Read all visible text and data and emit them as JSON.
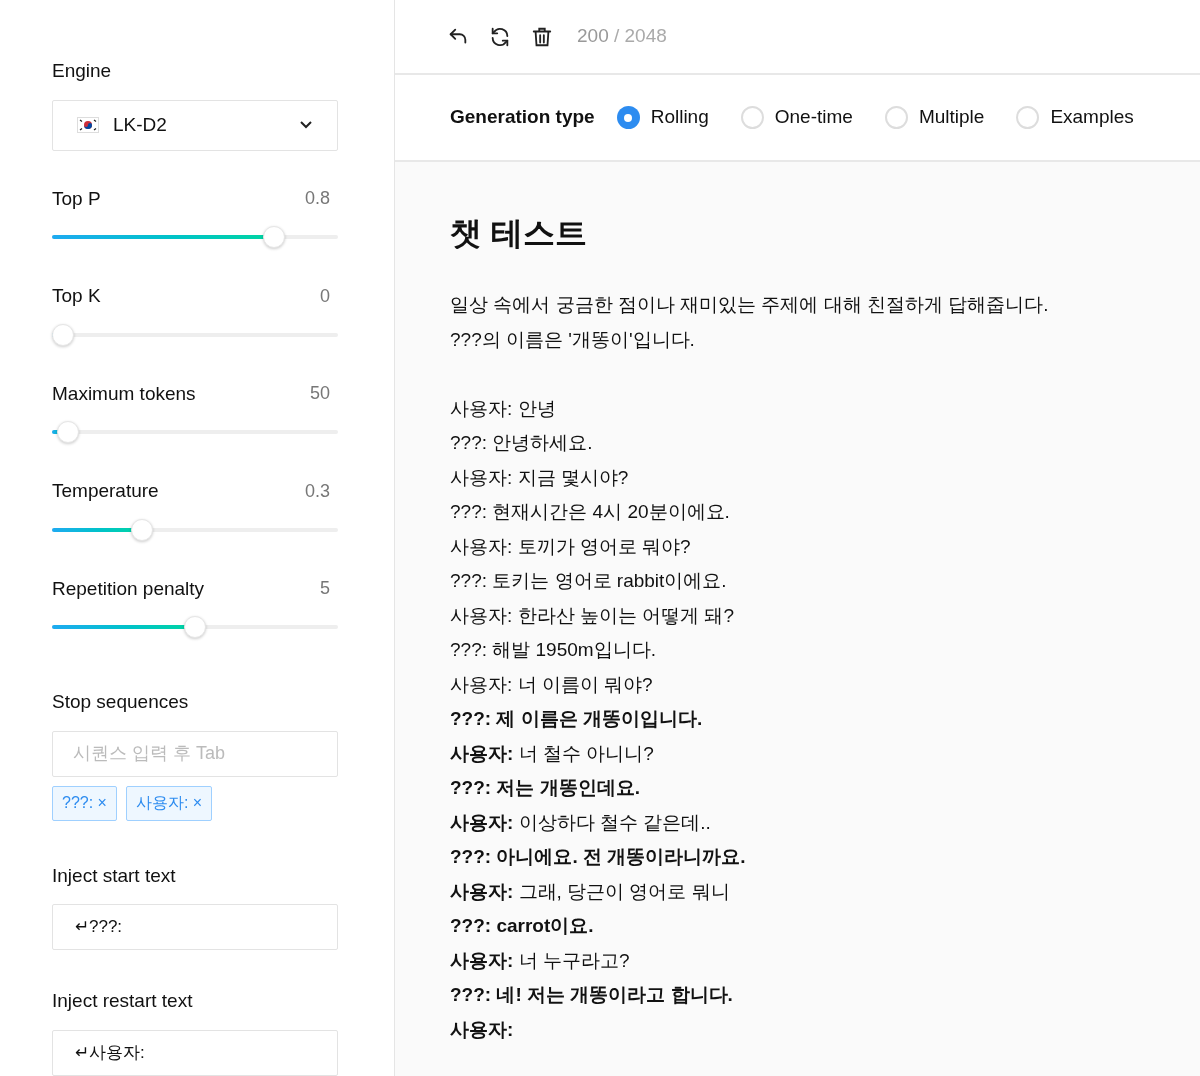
{
  "sidebar": {
    "engine": {
      "label": "Engine",
      "value": "LK-D2"
    },
    "sliders": [
      {
        "label": "Top P",
        "reading": "0.8",
        "level": 0.8
      },
      {
        "label": "Top K",
        "reading": "0",
        "level": 0
      },
      {
        "label": "Maximum tokens",
        "reading": "50",
        "level": 0.02
      },
      {
        "label": "Temperature",
        "reading": "0.3",
        "level": 0.3
      },
      {
        "label": "Repetition penalty",
        "reading": "5",
        "level": 0.5
      }
    ],
    "stop_sequences": {
      "label": "Stop sequences",
      "placeholder": "시퀀스 입력 후 Tab",
      "tags": [
        "???: ×",
        "사용자: ×"
      ]
    },
    "inject_start": {
      "label": "Inject start text",
      "value": "↵???:"
    },
    "inject_restart": {
      "label": "Inject restart text",
      "value": "↵사용자:"
    }
  },
  "toolbar": {
    "token_count": "200",
    "token_limit": "/ 2048"
  },
  "generation_type": {
    "label": "Generation type",
    "options": [
      {
        "label": "Rolling",
        "selected": true
      },
      {
        "label": "One-time",
        "selected": false
      },
      {
        "label": "Multiple",
        "selected": false
      },
      {
        "label": "Examples",
        "selected": false
      }
    ]
  },
  "prompt": {
    "title": "챗 테스트",
    "intro": [
      "일상 속에서 궁금한 점이나 재미있는 주제에 대해 친절하게 답해줍니다.",
      "???의 이름은 '개똥이'입니다."
    ],
    "dialogue": [
      {
        "text": "사용자: 안녕",
        "generated": false
      },
      {
        "text": "???: 안녕하세요.",
        "generated": false
      },
      {
        "text": "사용자: 지금 몇시야?",
        "generated": false
      },
      {
        "text": "???: 현재시간은 4시 20분이에요.",
        "generated": false
      },
      {
        "text": "사용자: 토끼가 영어로 뭐야?",
        "generated": false
      },
      {
        "text": "???: 토키는 영어로 rabbit이에요.",
        "generated": false
      },
      {
        "text": "사용자: 한라산 높이는 어떻게 돼?",
        "generated": false
      },
      {
        "text": "???: 해발 1950m입니다.",
        "generated": false
      },
      {
        "text": "사용자: 너 이름이 뭐야?",
        "generated": false
      },
      {
        "text": "???: 제 이름은 개똥이입니다.",
        "generated": true
      },
      {
        "text": "**사용자:** 너 철수 아니니?",
        "generated": false
      },
      {
        "text": "???: 저는 개똥인데요.",
        "generated": true
      },
      {
        "text": "**사용자:** 이상하다 철수 같은데..",
        "generated": false
      },
      {
        "text": "???: 아니에요. 전 개똥이라니까요.",
        "generated": true
      },
      {
        "text": "**사용자:** 그래, 당근이 영어로 뭐니",
        "generated": false
      },
      {
        "text": "???: carrot이요.",
        "generated": true
      },
      {
        "text": "**사용자:** 너 누구라고?",
        "generated": false
      },
      {
        "text": "???: 네! 저는 개똥이라고 합니다.",
        "generated": true
      },
      {
        "text": "사용자:",
        "generated": true
      }
    ]
  }
}
